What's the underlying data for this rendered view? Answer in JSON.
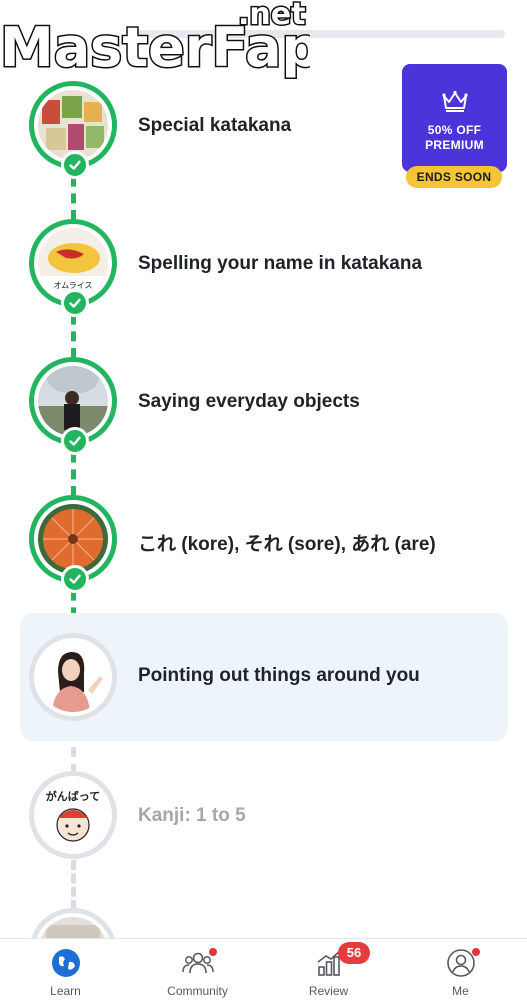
{
  "watermark": {
    "text": "MasterFap",
    "suffix": ".net"
  },
  "promo": {
    "line1": "50% OFF",
    "line2": "PREMIUM",
    "tag": "ENDS SOON",
    "icon": "crown-icon"
  },
  "lessons": [
    {
      "title": "Special katakana",
      "status": "completed",
      "thumb": "vegetables-photo"
    },
    {
      "title": "Spelling your name in katakana",
      "status": "completed",
      "thumb": "omurice-photo",
      "thumb_caption": "オムライス"
    },
    {
      "title": "Saying everyday objects",
      "status": "completed",
      "thumb": "person-photo"
    },
    {
      "title": "これ (kore), それ (sore), あれ (are)",
      "status": "completed",
      "thumb": "umbrella-photo"
    },
    {
      "title": "Pointing out things around you",
      "status": "current",
      "thumb": "woman-pointing-photo"
    },
    {
      "title": "Kanji: 1 to 5",
      "status": "locked",
      "thumb": "ganbatte-illustration",
      "thumb_caption": "がんばって"
    }
  ],
  "tabbar": {
    "tabs": [
      {
        "label": "Learn",
        "icon": "globe-icon",
        "active": true
      },
      {
        "label": "Community",
        "icon": "people-icon",
        "notification_dot": true
      },
      {
        "label": "Review",
        "icon": "chart-icon",
        "badge": "56"
      },
      {
        "label": "Me",
        "icon": "profile-icon",
        "notification_dot": true
      }
    ]
  },
  "colors": {
    "complete_green": "#22b45e",
    "promo_purple": "#4b34d9",
    "promo_yellow": "#f6c535",
    "current_bg": "#eef5fa",
    "badge_red": "#e33d3d",
    "learn_blue": "#1d6fd6"
  }
}
